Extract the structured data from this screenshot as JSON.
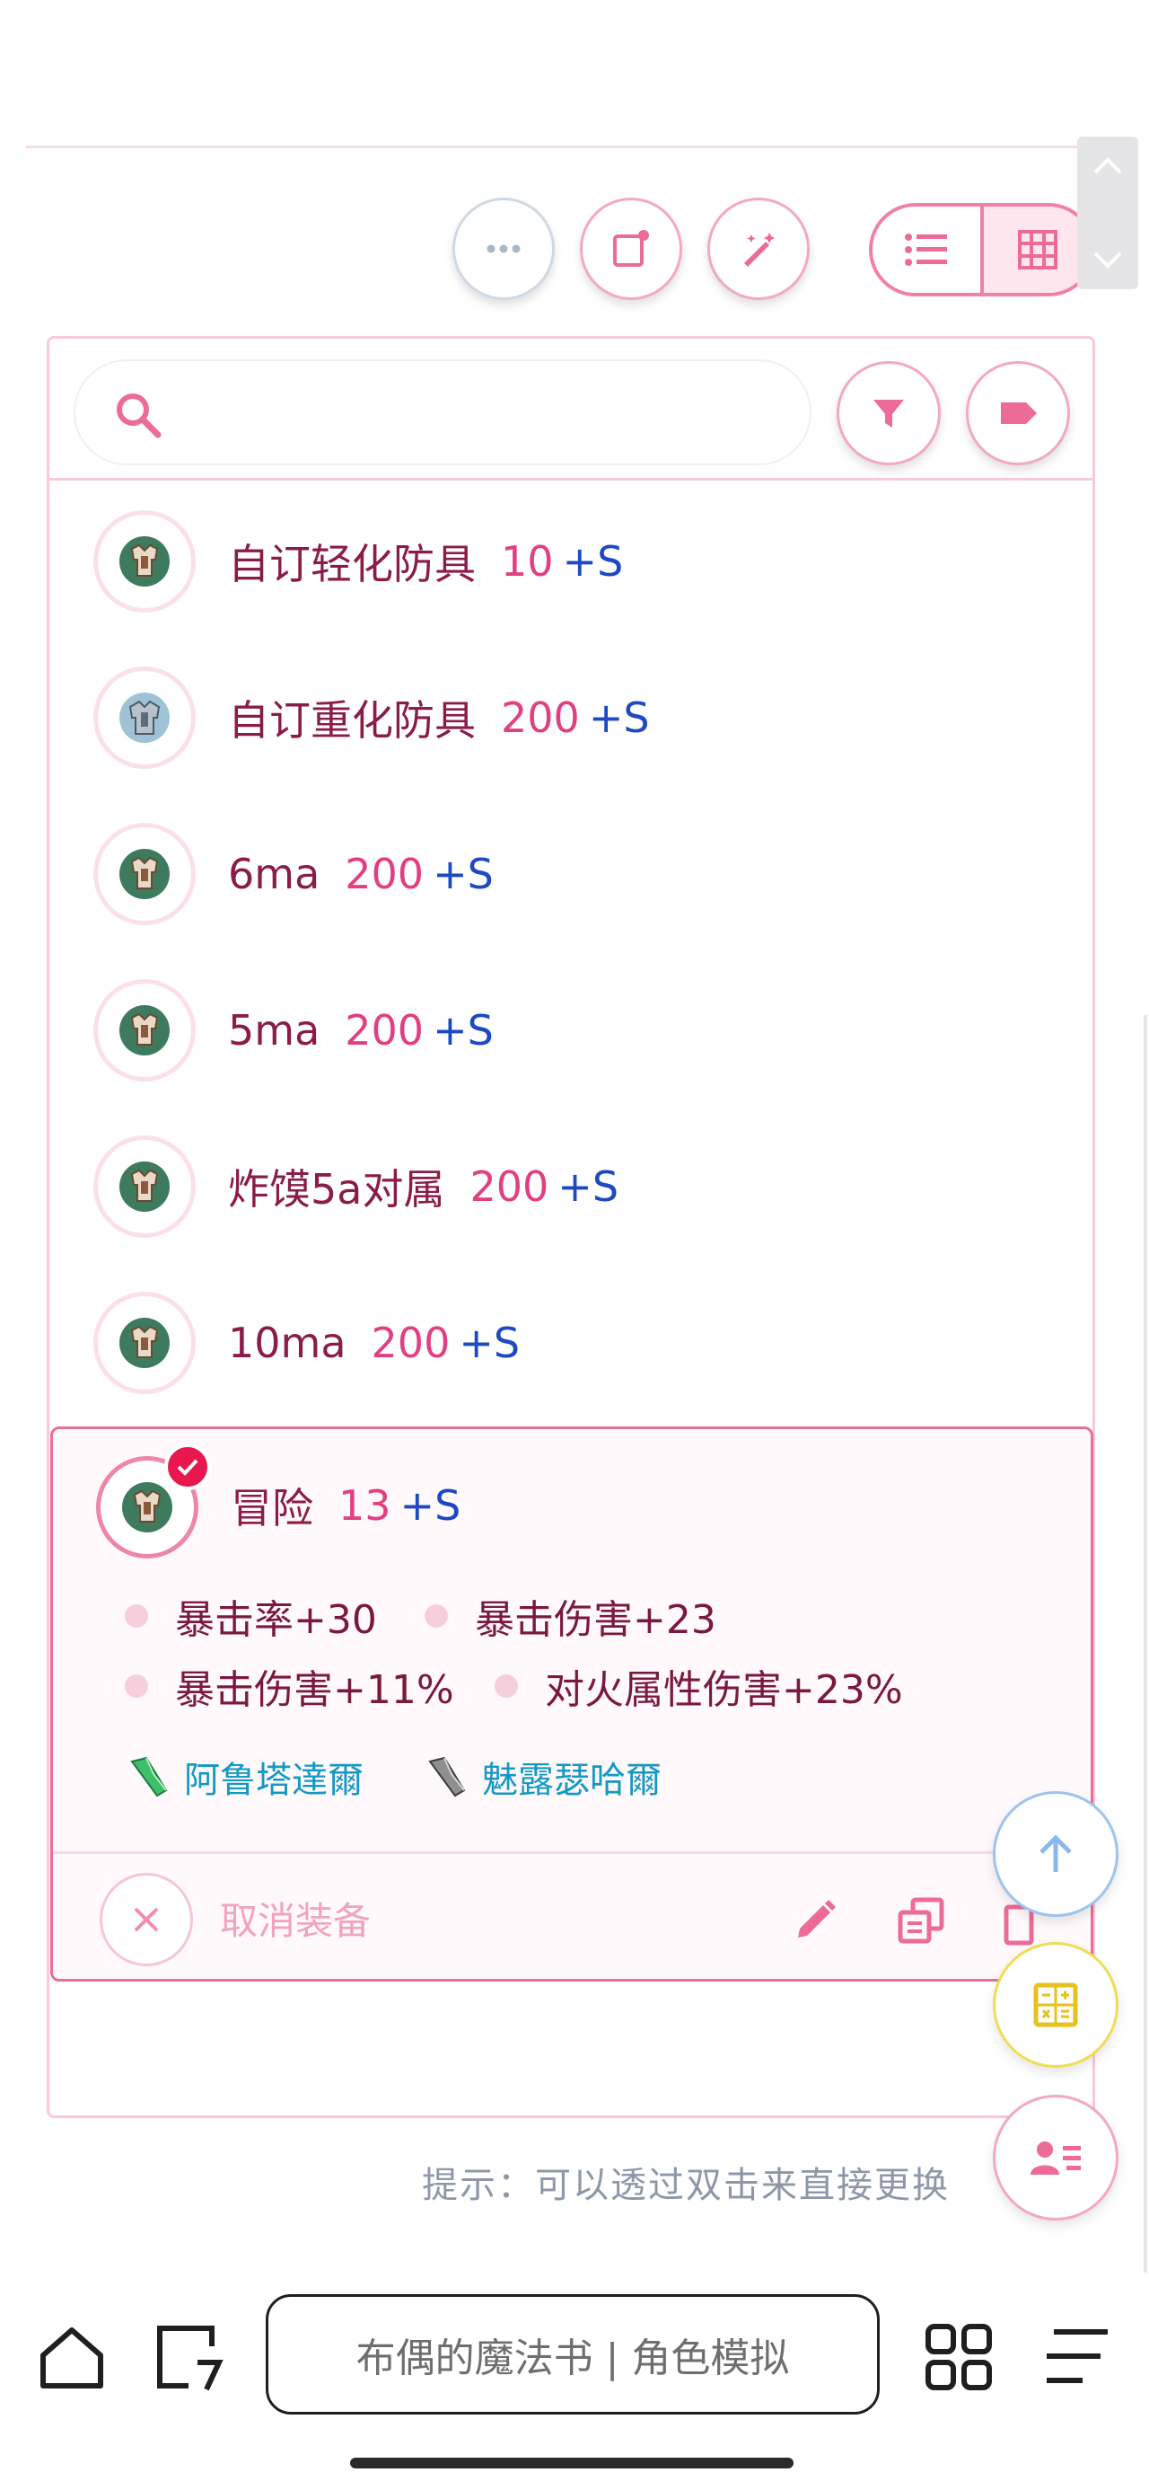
{
  "search": {
    "placeholder": ""
  },
  "items": [
    {
      "name": "自订轻化防具",
      "level": "10",
      "suffix": "+S",
      "icon": "armor-icon"
    },
    {
      "name": "自订重化防具",
      "level": "200",
      "suffix": "+S",
      "icon": "armor-icon"
    },
    {
      "name": "6ma",
      "level": "200",
      "suffix": "+S",
      "icon": "armor-icon"
    },
    {
      "name": "5ma",
      "level": "200",
      "suffix": "+S",
      "icon": "armor-icon"
    },
    {
      "name": "炸馍5a对属",
      "level": "200",
      "suffix": "+S",
      "icon": "armor-icon"
    },
    {
      "name": "10ma",
      "level": "200",
      "suffix": "+S",
      "icon": "armor-icon"
    }
  ],
  "selected": {
    "name": "冒险",
    "level": "13",
    "suffix": "+S",
    "stats": [
      "暴击率+30",
      "暴击伤害+23",
      "暴击伤害+11%",
      "对火属性伤害+23%"
    ],
    "crystals": [
      "阿鲁塔達爾",
      "魅露瑟哈爾"
    ],
    "cancel_label": "取消装备"
  },
  "hint": "提示：可以透过双击来直接更换",
  "nav": {
    "title": "布偶的魔法书 | 角色模拟"
  },
  "colors": {
    "accent": "#e23f82",
    "border": "#f8c9d8",
    "suffix": "#1d49c2"
  }
}
